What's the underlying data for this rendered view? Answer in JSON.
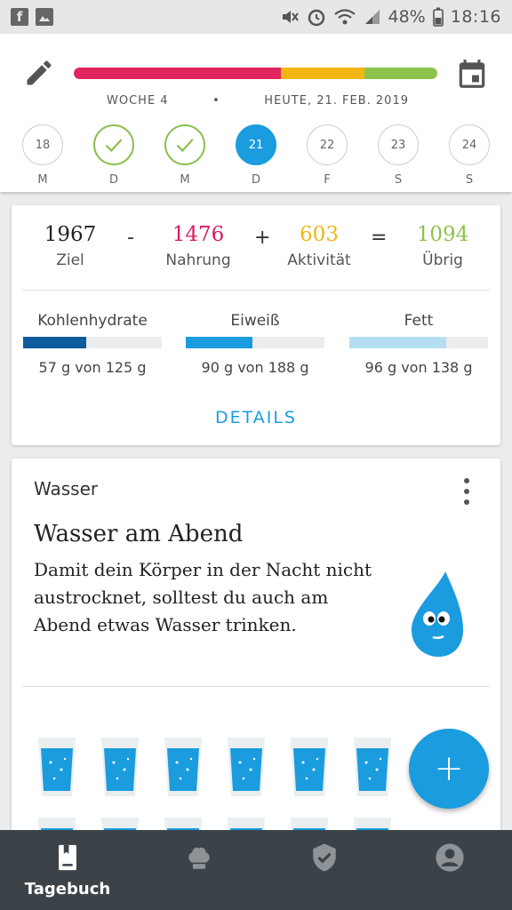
{
  "status_bar": {
    "left_icons": [
      "facebook-icon",
      "gallery-icon"
    ],
    "battery": "48%",
    "time": "18:16"
  },
  "header": {
    "week": "WOCHE 4",
    "separator": "•",
    "date": "HEUTE, 21. FEB. 2019",
    "progress": [
      {
        "color": "#e0245e",
        "fraction": 0.57
      },
      {
        "color": "#f3b614",
        "fraction": 0.23
      },
      {
        "color": "#8cc34a",
        "fraction": 0.2
      }
    ],
    "days": [
      {
        "num": "18",
        "letter": "M",
        "state": "normal"
      },
      {
        "num": "",
        "letter": "D",
        "state": "done"
      },
      {
        "num": "",
        "letter": "M",
        "state": "done"
      },
      {
        "num": "21",
        "letter": "D",
        "state": "active"
      },
      {
        "num": "22",
        "letter": "F",
        "state": "normal"
      },
      {
        "num": "23",
        "letter": "S",
        "state": "normal"
      },
      {
        "num": "24",
        "letter": "S",
        "state": "normal"
      }
    ]
  },
  "summary": {
    "goal": {
      "value": "1967",
      "label": "Ziel",
      "color": "#222222"
    },
    "minus": "-",
    "food": {
      "value": "1476",
      "label": "Nahrung",
      "color": "#d81b60"
    },
    "plus": "+",
    "activity": {
      "value": "603",
      "label": "Aktivität",
      "color": "#f3b614"
    },
    "equals": "=",
    "remaining": {
      "value": "1094",
      "label": "Übrig",
      "color": "#8cc34a"
    },
    "macros": [
      {
        "name": "Kohlenhydrate",
        "value": "57 g von 125 g",
        "fraction": 0.456,
        "color": "#0d5c9c"
      },
      {
        "name": "Eiweiß",
        "value": "90 g von 188 g",
        "fraction": 0.479,
        "color": "#1a9cdf"
      },
      {
        "name": "Fett",
        "value": "96 g von 138 g",
        "fraction": 0.696,
        "color": "#b5def5"
      }
    ],
    "details": "DETAILS"
  },
  "water": {
    "title": "Wasser",
    "heading": "Wasser am Abend",
    "text": "Damit dein Körper in der Nacht nicht austrocknet, solltest du auch am Abend etwas Wasser trinken."
  },
  "fab": {
    "label": "+"
  },
  "bottom_nav": {
    "items": [
      {
        "label": "Tagebuch",
        "icon": "diary-icon",
        "active": true
      },
      {
        "label": "",
        "icon": "chef-hat-icon",
        "active": false
      },
      {
        "label": "",
        "icon": "shield-check-icon",
        "active": false
      },
      {
        "label": "",
        "icon": "profile-icon",
        "active": false
      }
    ]
  }
}
